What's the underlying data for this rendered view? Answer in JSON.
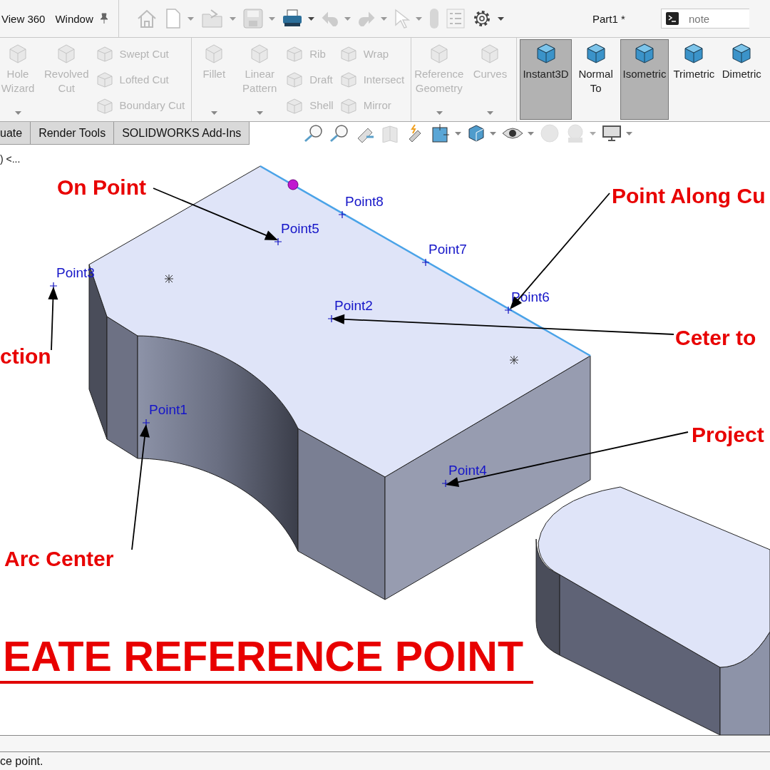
{
  "menu": [
    "View 360",
    "Window"
  ],
  "document_title": "Part1 *",
  "search": {
    "placeholder": "note"
  },
  "ribbon": {
    "groups": [
      {
        "columns": [
          {
            "kind": "large",
            "items": [
              {
                "label": "Hole\nWizard",
                "disabled": true,
                "selected": false,
                "dropdown": true
              }
            ]
          },
          {
            "kind": "large",
            "items": [
              {
                "label": "Revolved\nCut",
                "disabled": true,
                "selected": false,
                "dropdown": false
              }
            ]
          },
          {
            "kind": "stack",
            "items": [
              {
                "label": "Swept Cut",
                "disabled": true,
                "selected": false
              },
              {
                "label": "Lofted Cut",
                "disabled": true,
                "selected": false
              },
              {
                "label": "Boundary Cut",
                "disabled": true,
                "selected": false
              }
            ]
          }
        ]
      },
      {
        "columns": [
          {
            "kind": "large",
            "items": [
              {
                "label": "Fillet",
                "disabled": true,
                "selected": false,
                "dropdown": true
              }
            ]
          },
          {
            "kind": "large",
            "items": [
              {
                "label": "Linear\nPattern",
                "disabled": true,
                "selected": false,
                "dropdown": true
              }
            ]
          },
          {
            "kind": "stack",
            "items": [
              {
                "label": "Rib",
                "disabled": true,
                "selected": false
              },
              {
                "label": "Draft",
                "disabled": true,
                "selected": false
              },
              {
                "label": "Shell",
                "disabled": true,
                "selected": false
              }
            ]
          },
          {
            "kind": "stack",
            "items": [
              {
                "label": "Wrap",
                "disabled": true,
                "selected": false
              },
              {
                "label": "Intersect",
                "disabled": true,
                "selected": false
              },
              {
                "label": "Mirror",
                "disabled": true,
                "selected": false
              }
            ]
          }
        ]
      },
      {
        "columns": [
          {
            "kind": "large",
            "items": [
              {
                "label": "Reference\nGeometry",
                "disabled": true,
                "selected": false,
                "dropdown": true
              }
            ]
          },
          {
            "kind": "large",
            "items": [
              {
                "label": "Curves",
                "disabled": true,
                "selected": false,
                "dropdown": true
              }
            ]
          }
        ]
      },
      {
        "columns": [
          {
            "kind": "view",
            "items": [
              {
                "label": "Instant3D",
                "disabled": false,
                "selected": true,
                "dropdown": false
              }
            ]
          },
          {
            "kind": "view",
            "items": [
              {
                "label": "Normal\nTo",
                "disabled": false,
                "selected": false,
                "dropdown": false
              }
            ]
          },
          {
            "kind": "view",
            "items": [
              {
                "label": "Isometric",
                "disabled": false,
                "selected": true,
                "dropdown": false
              }
            ]
          },
          {
            "kind": "view",
            "items": [
              {
                "label": "Trimetric",
                "disabled": false,
                "selected": false,
                "dropdown": false
              }
            ]
          },
          {
            "kind": "view",
            "items": [
              {
                "label": "Dimetric",
                "disabled": false,
                "selected": false,
                "dropdown": false
              }
            ]
          }
        ]
      }
    ]
  },
  "tabs": [
    {
      "label": "uate",
      "selected": false
    },
    {
      "label": "Render Tools",
      "selected": false
    },
    {
      "label": "SOLIDWORKS Add-Ins",
      "selected": false
    }
  ],
  "tree_text": ") <...",
  "viewport": {
    "point_labels": [
      "Point8",
      "Point5",
      "Point7",
      "Point3",
      "Point6",
      "Point2",
      "Point1",
      "Point4"
    ],
    "callouts": [
      "On Point",
      "Point Along Cu",
      "Ceter to",
      "ction",
      "Project",
      "Arc Center"
    ],
    "title": "EATE REFERENCE POINT"
  },
  "status_bar": "ce point."
}
